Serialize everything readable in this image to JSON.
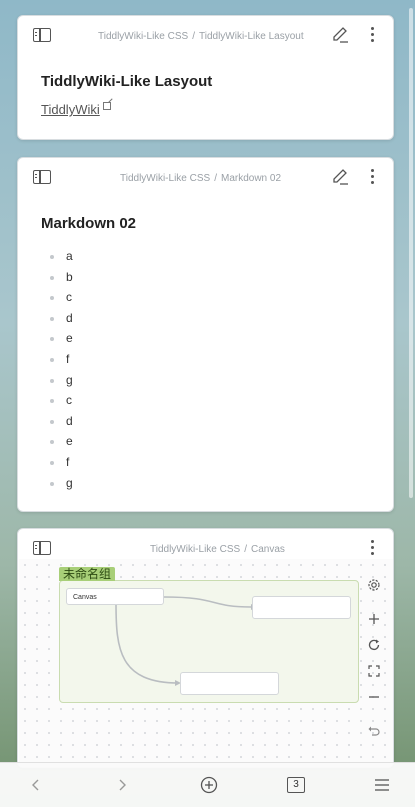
{
  "cards": [
    {
      "breadcrumb": [
        "TiddlyWiki-Like CSS",
        "TiddlyWiki-Like Lasyout"
      ],
      "title": "TiddlyWiki-Like Lasyout",
      "link_text": "TiddlyWiki"
    },
    {
      "breadcrumb": [
        "TiddlyWiki-Like CSS",
        "Markdown 02"
      ],
      "title": "Markdown 02",
      "list_items": [
        "a",
        "b",
        "c",
        "d",
        "e",
        "f",
        "g",
        "c",
        "d",
        "e",
        "f",
        "g"
      ]
    },
    {
      "breadcrumb": [
        "TiddlyWiki-Like CSS",
        "Canvas"
      ],
      "canvas": {
        "group_label": "未命名组",
        "node_label": "Canvas",
        "empty_nodes": 2
      }
    }
  ],
  "breadcrumb_separator": "/",
  "bottom_bar": {
    "tab_count": "3",
    "icons": [
      "chevron-left-icon",
      "chevron-right-icon",
      "plus-circle-icon",
      "tabs-count-icon",
      "menu-icon"
    ]
  },
  "colors": {
    "group_fill": "#f3f7ec",
    "group_label": "#a8cf78",
    "muted_text": "#9aa0a6"
  }
}
